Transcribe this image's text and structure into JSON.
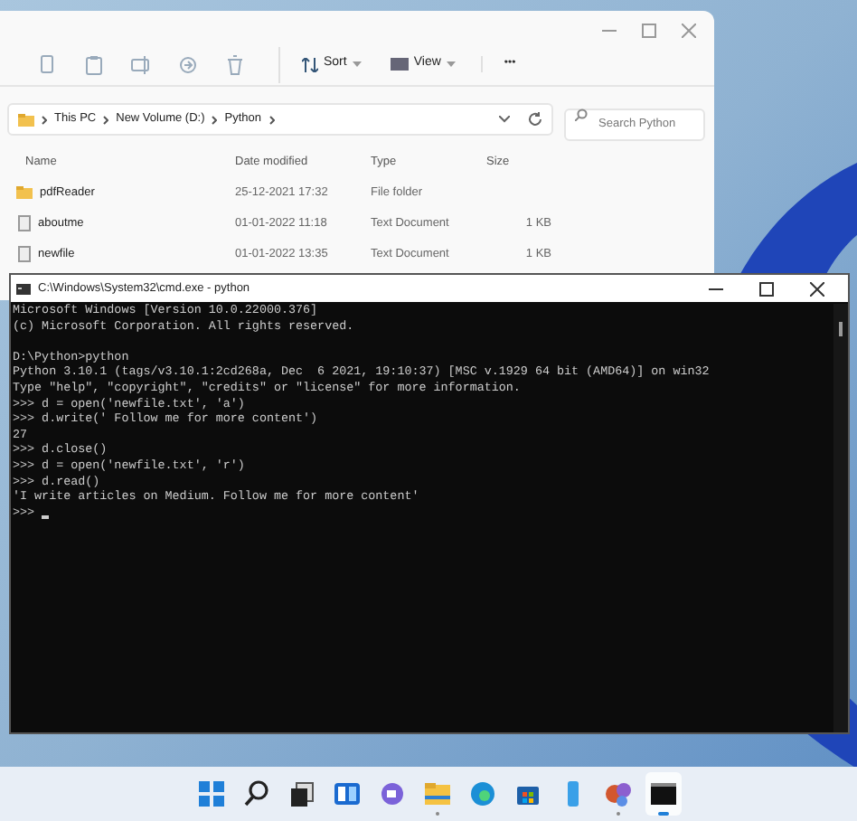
{
  "explorer": {
    "toolbar": [
      {
        "kind": "copy"
      },
      {
        "kind": "paste"
      },
      {
        "kind": "rename"
      },
      {
        "kind": "share"
      },
      {
        "kind": "delete"
      },
      {
        "kind": "sort",
        "label": "Sort"
      },
      {
        "kind": "view",
        "label": "View"
      },
      {
        "kind": "more",
        "label": "•••"
      }
    ],
    "breadcrumbs": [
      "This PC",
      "New Volume (D:)",
      "Python"
    ],
    "search": {
      "placeholder": "Search Python"
    },
    "columns": [
      "Name",
      "Date modified",
      "Type",
      "Size"
    ],
    "rows": [
      {
        "kind": "folder",
        "name": "pdfReader",
        "date": "25-12-2021 17:32",
        "type": "File folder",
        "size": ""
      },
      {
        "kind": "file",
        "name": "aboutme",
        "date": "01-01-2022 11:18",
        "type": "Text Document",
        "size": "1 KB"
      },
      {
        "kind": "file",
        "name": "newfile",
        "date": "01-01-2022 13:35",
        "type": "Text Document",
        "size": "1 KB"
      }
    ]
  },
  "console": {
    "title": "C:\\Windows\\System32\\cmd.exe - python",
    "header_lines": [
      "Microsoft Windows [Version 10.0.22000.376]",
      "(c) Microsoft Corporation. All rights reserved."
    ],
    "lines": [
      "D:\\Python>python",
      "Python 3.10.1 (tags/v3.10.1:2cd268a, Dec  6 2021, 19:10:37) [MSC v.1929 64 bit (AMD64)] on win32",
      "Type \"help\", \"copyright\", \"credits\" or \"license\" for more information.",
      ">>> d = open('newfile.txt', 'a')",
      ">>> d.write(' Follow me for more content')",
      "27",
      ">>> d.close()",
      ">>> d = open('newfile.txt', 'r')",
      ">>> d.read()",
      "'I write articles on Medium. Follow me for more content'"
    ],
    "prompt": ">>>"
  },
  "taskbar": [
    {
      "kind": "start",
      "running": false,
      "selected": false
    },
    {
      "kind": "search",
      "running": false,
      "selected": false
    },
    {
      "kind": "taskview",
      "running": false,
      "selected": false
    },
    {
      "kind": "widgets",
      "running": false,
      "selected": false
    },
    {
      "kind": "chat",
      "running": false,
      "selected": false
    },
    {
      "kind": "explorer",
      "running": true,
      "selected": false
    },
    {
      "kind": "edge",
      "running": false,
      "selected": false
    },
    {
      "kind": "store",
      "running": false,
      "selected": false
    },
    {
      "kind": "phone",
      "running": false,
      "selected": false
    },
    {
      "kind": "apps",
      "running": true,
      "selected": false
    },
    {
      "kind": "terminal",
      "running": true,
      "selected": true
    }
  ]
}
